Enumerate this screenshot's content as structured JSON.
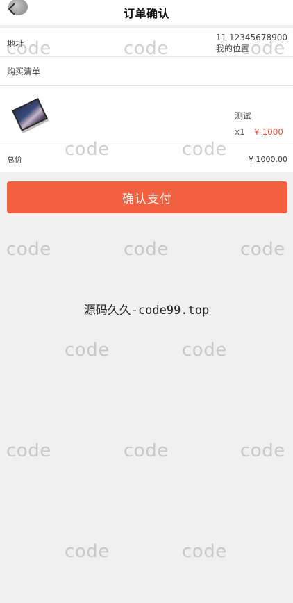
{
  "header": {
    "title": "订单确认",
    "back_icon": "chevron-left-icon"
  },
  "address": {
    "label": "地址",
    "contact": "11 12345678900",
    "location": "我的位置"
  },
  "cart": {
    "title": "购买清单",
    "items": [
      {
        "name": "测试",
        "quantity": "x1",
        "price": "¥ 1000"
      }
    ]
  },
  "total": {
    "label": "总价",
    "value": "¥ 1000.00"
  },
  "confirm_button": {
    "label": "确认支付"
  },
  "site_text": "源码久久-code99.top",
  "watermark": {
    "text": "code"
  },
  "colors": {
    "accent": "#f2603f",
    "price": "#e8543b",
    "background": "#f0f0f0"
  }
}
